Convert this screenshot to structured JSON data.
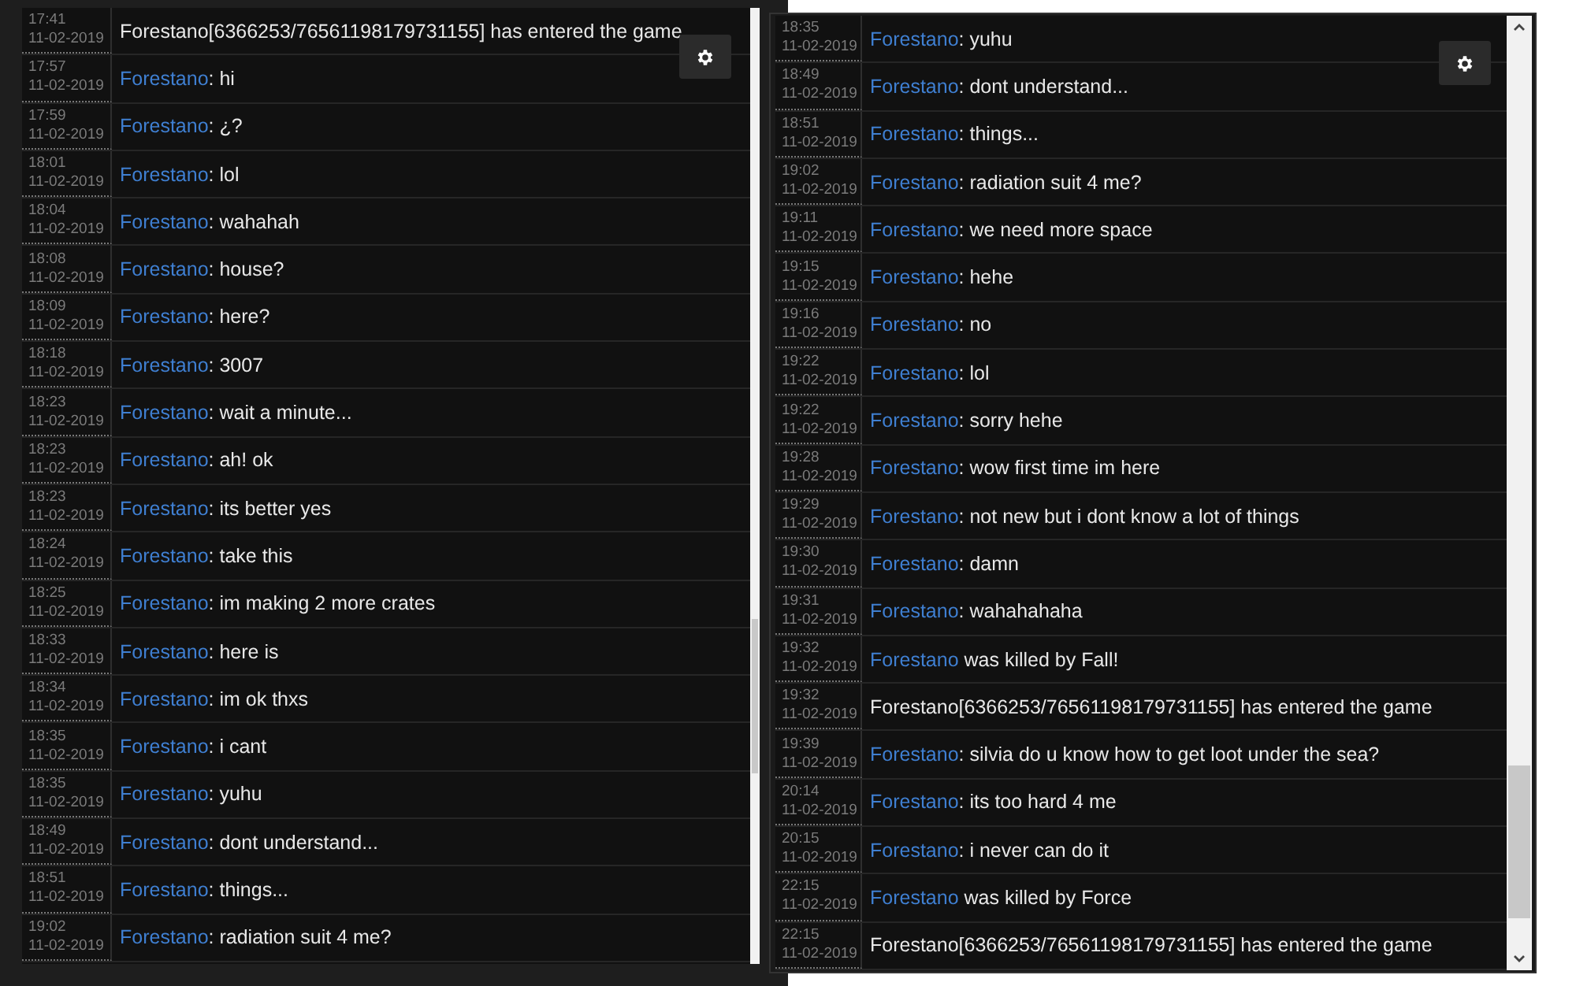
{
  "panels": [
    {
      "messages": [
        {
          "kind": "system",
          "time": "17:41",
          "date": "11-02-2019",
          "text": "Forestano[6366253/76561198179731155] has entered the game"
        },
        {
          "kind": "chat",
          "time": "17:57",
          "date": "11-02-2019",
          "name": "Forestano",
          "text": ": hi"
        },
        {
          "kind": "chat",
          "time": "17:59",
          "date": "11-02-2019",
          "name": "Forestano",
          "text": ": ¿?"
        },
        {
          "kind": "chat",
          "time": "18:01",
          "date": "11-02-2019",
          "name": "Forestano",
          "text": ": lol"
        },
        {
          "kind": "chat",
          "time": "18:04",
          "date": "11-02-2019",
          "name": "Forestano",
          "text": ": wahahah"
        },
        {
          "kind": "chat",
          "time": "18:08",
          "date": "11-02-2019",
          "name": "Forestano",
          "text": ": house?"
        },
        {
          "kind": "chat",
          "time": "18:09",
          "date": "11-02-2019",
          "name": "Forestano",
          "text": ": here?"
        },
        {
          "kind": "chat",
          "time": "18:18",
          "date": "11-02-2019",
          "name": "Forestano",
          "text": ": 3007"
        },
        {
          "kind": "chat",
          "time": "18:23",
          "date": "11-02-2019",
          "name": "Forestano",
          "text": ": wait a minute..."
        },
        {
          "kind": "chat",
          "time": "18:23",
          "date": "11-02-2019",
          "name": "Forestano",
          "text": ": ah! ok"
        },
        {
          "kind": "chat",
          "time": "18:23",
          "date": "11-02-2019",
          "name": "Forestano",
          "text": ": its better yes"
        },
        {
          "kind": "chat",
          "time": "18:24",
          "date": "11-02-2019",
          "name": "Forestano",
          "text": ": take this"
        },
        {
          "kind": "chat",
          "time": "18:25",
          "date": "11-02-2019",
          "name": "Forestano",
          "text": ": im making 2 more crates"
        },
        {
          "kind": "chat",
          "time": "18:33",
          "date": "11-02-2019",
          "name": "Forestano",
          "text": ": here is"
        },
        {
          "kind": "chat",
          "time": "18:34",
          "date": "11-02-2019",
          "name": "Forestano",
          "text": ": im ok thxs"
        },
        {
          "kind": "chat",
          "time": "18:35",
          "date": "11-02-2019",
          "name": "Forestano",
          "text": ": i cant"
        },
        {
          "kind": "chat",
          "time": "18:35",
          "date": "11-02-2019",
          "name": "Forestano",
          "text": ": yuhu"
        },
        {
          "kind": "chat",
          "time": "18:49",
          "date": "11-02-2019",
          "name": "Forestano",
          "text": ": dont understand..."
        },
        {
          "kind": "chat",
          "time": "18:51",
          "date": "11-02-2019",
          "name": "Forestano",
          "text": ": things..."
        },
        {
          "kind": "chat",
          "time": "19:02",
          "date": "11-02-2019",
          "name": "Forestano",
          "text": ": radiation suit 4 me?"
        }
      ]
    },
    {
      "messages": [
        {
          "kind": "chat",
          "time": "18:35",
          "date": "11-02-2019",
          "name": "Forestano",
          "text": ": yuhu"
        },
        {
          "kind": "chat",
          "time": "18:49",
          "date": "11-02-2019",
          "name": "Forestano",
          "text": ": dont understand..."
        },
        {
          "kind": "chat",
          "time": "18:51",
          "date": "11-02-2019",
          "name": "Forestano",
          "text": ": things..."
        },
        {
          "kind": "chat",
          "time": "19:02",
          "date": "11-02-2019",
          "name": "Forestano",
          "text": ": radiation suit 4 me?"
        },
        {
          "kind": "chat",
          "time": "19:11",
          "date": "11-02-2019",
          "name": "Forestano",
          "text": ": we need more space"
        },
        {
          "kind": "chat",
          "time": "19:15",
          "date": "11-02-2019",
          "name": "Forestano",
          "text": ": hehe"
        },
        {
          "kind": "chat",
          "time": "19:16",
          "date": "11-02-2019",
          "name": "Forestano",
          "text": ": no"
        },
        {
          "kind": "chat",
          "time": "19:22",
          "date": "11-02-2019",
          "name": "Forestano",
          "text": ": lol"
        },
        {
          "kind": "chat",
          "time": "19:22",
          "date": "11-02-2019",
          "name": "Forestano",
          "text": ": sorry hehe"
        },
        {
          "kind": "chat",
          "time": "19:28",
          "date": "11-02-2019",
          "name": "Forestano",
          "text": ": wow first time im here"
        },
        {
          "kind": "chat",
          "time": "19:29",
          "date": "11-02-2019",
          "name": "Forestano",
          "text": ": not new but i dont know a lot of things"
        },
        {
          "kind": "chat",
          "time": "19:30",
          "date": "11-02-2019",
          "name": "Forestano",
          "text": ": damn"
        },
        {
          "kind": "chat",
          "time": "19:31",
          "date": "11-02-2019",
          "name": "Forestano",
          "text": ": wahahahaha"
        },
        {
          "kind": "event",
          "time": "19:32",
          "date": "11-02-2019",
          "name": "Forestano",
          "text": " was killed by Fall!"
        },
        {
          "kind": "system",
          "time": "19:32",
          "date": "11-02-2019",
          "text": "Forestano[6366253/76561198179731155] has entered the game"
        },
        {
          "kind": "chat",
          "time": "19:39",
          "date": "11-02-2019",
          "name": "Forestano",
          "text": ": silvia do u know how to get loot under the sea?"
        },
        {
          "kind": "chat",
          "time": "20:14",
          "date": "11-02-2019",
          "name": "Forestano",
          "text": ": its too hard 4 me"
        },
        {
          "kind": "chat",
          "time": "20:15",
          "date": "11-02-2019",
          "name": "Forestano",
          "text": ": i never can do it"
        },
        {
          "kind": "event",
          "time": "22:15",
          "date": "11-02-2019",
          "name": "Forestano",
          "text": " was killed by Force"
        },
        {
          "kind": "system",
          "time": "22:15",
          "date": "11-02-2019",
          "text": "Forestano[6366253/76561198179731155] has entered the game"
        }
      ]
    }
  ]
}
